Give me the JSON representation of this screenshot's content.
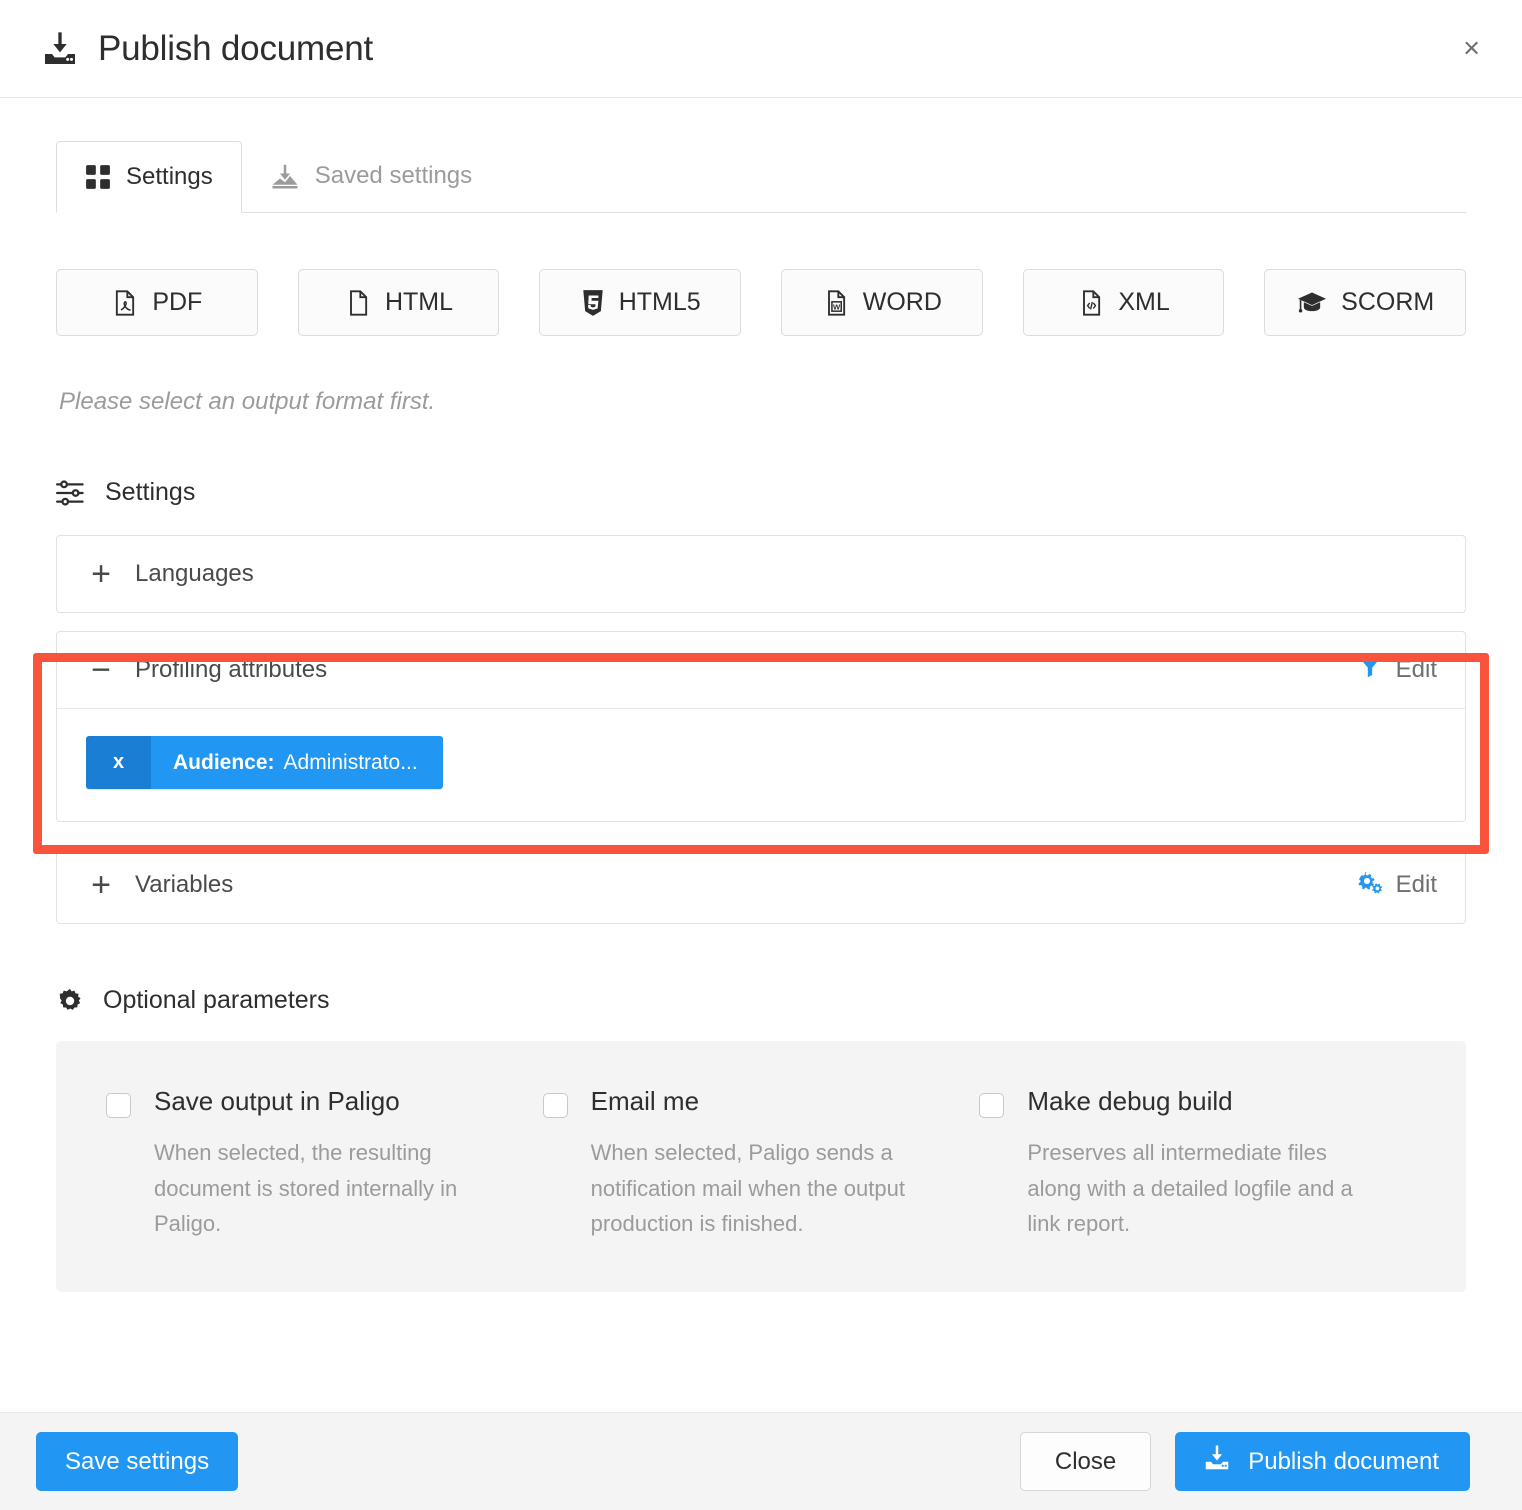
{
  "header": {
    "title": "Publish document",
    "icon": "publish-download-icon",
    "close_label": "×"
  },
  "tabs": [
    {
      "label": "Settings",
      "icon": "grid-squares-icon",
      "active": true
    },
    {
      "label": "Saved settings",
      "icon": "save-download-icon",
      "active": false
    }
  ],
  "formats": [
    {
      "label": "PDF",
      "icon": "pdf-file-icon"
    },
    {
      "label": "HTML",
      "icon": "html-file-icon"
    },
    {
      "label": "HTML5",
      "icon": "html5-shield-icon"
    },
    {
      "label": "WORD",
      "icon": "word-file-icon"
    },
    {
      "label": "XML",
      "icon": "xml-file-icon"
    },
    {
      "label": "SCORM",
      "icon": "graduation-cap-icon"
    }
  ],
  "hint": "Please select an output format first.",
  "settings_section": {
    "heading": "Settings",
    "heading_icon": "sliders-icon",
    "accordions": [
      {
        "title": "Languages",
        "sign": "+",
        "expanded": false,
        "edit_label": "",
        "edit_icon": ""
      },
      {
        "title": "Profiling attributes",
        "sign": "−",
        "expanded": true,
        "edit_label": "Edit",
        "edit_icon": "filter-funnel-icon",
        "highlighted": true,
        "tags": [
          {
            "remove_label": "x",
            "key": "Audience:",
            "value": "Administrato..."
          }
        ]
      },
      {
        "title": "Variables",
        "sign": "+",
        "expanded": false,
        "edit_label": "Edit",
        "edit_icon": "gears-icon"
      }
    ]
  },
  "optional_parameters": {
    "heading": "Optional parameters",
    "heading_icon": "gear-icon",
    "options": [
      {
        "label": "Save output in Paligo",
        "description": "When selected, the resulting document is stored internally in Paligo.",
        "checked": false
      },
      {
        "label": "Email me",
        "description": "When selected, Paligo sends a notification mail when the output production is finished.",
        "checked": false
      },
      {
        "label": "Make debug build",
        "description": "Preserves all intermediate files along with a detailed logfile and a link report.",
        "checked": false
      }
    ]
  },
  "footer": {
    "save_settings_label": "Save settings",
    "close_label": "Close",
    "publish_label": "Publish document",
    "publish_icon": "publish-download-icon"
  },
  "colors": {
    "accent_blue": "#2196f3",
    "tag_dark_blue": "#1a7fd4",
    "highlight_red": "#f9533c",
    "panel_gray": "#f4f4f4",
    "muted_text": "#9b9b9b"
  }
}
